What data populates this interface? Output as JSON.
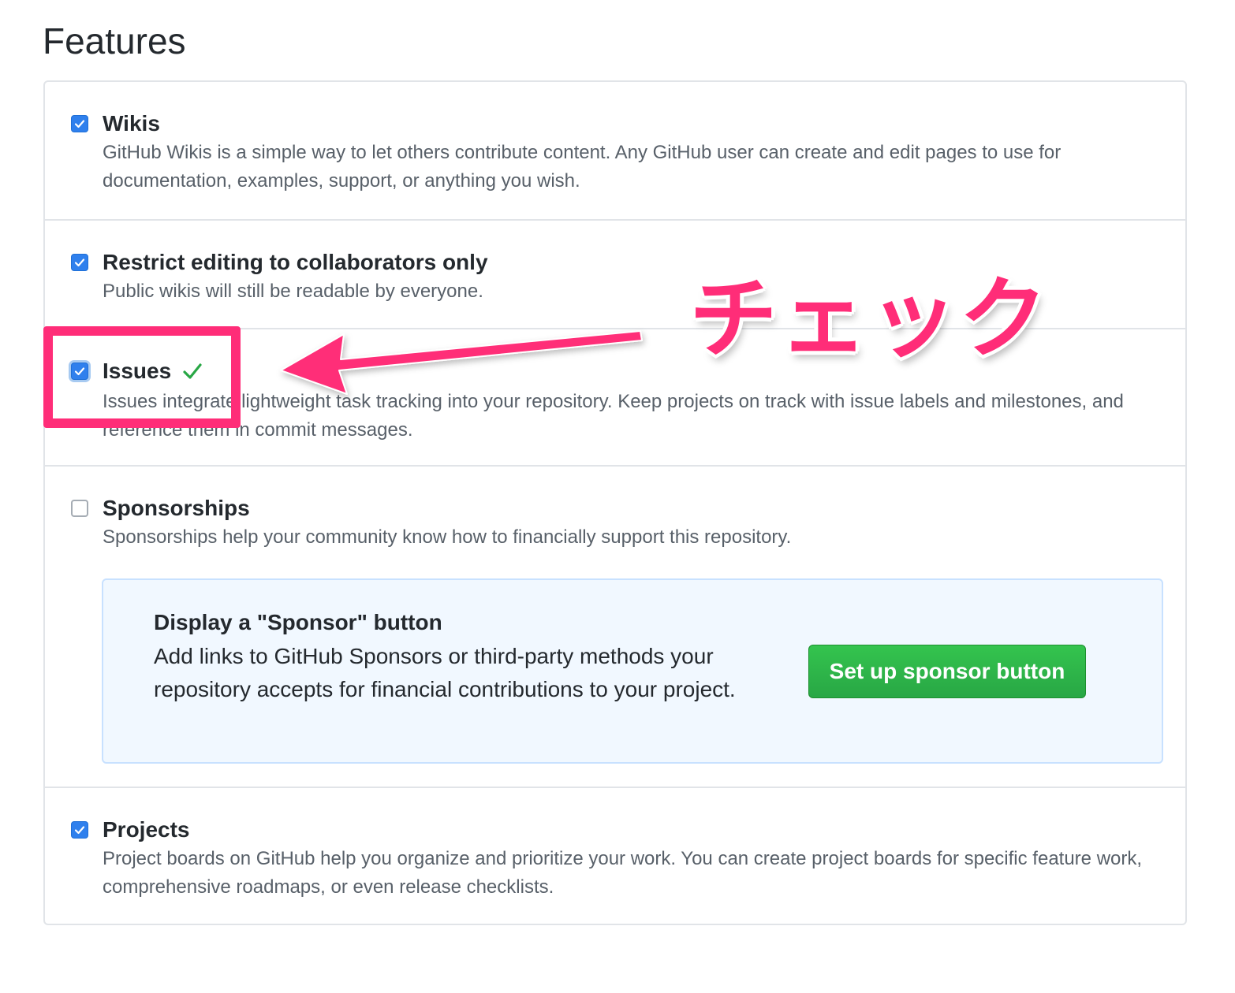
{
  "page": {
    "title": "Features"
  },
  "features": [
    {
      "id": "wikis",
      "title": "Wikis",
      "description": "GitHub Wikis is a simple way to let others contribute content. Any GitHub user can create and edit pages to use for documentation, examples, support, or anything you wish.",
      "checked": true
    },
    {
      "id": "restrict-editing",
      "title": "Restrict editing to collaborators only",
      "description": "Public wikis will still be readable by everyone.",
      "checked": true
    },
    {
      "id": "issues",
      "title": "Issues",
      "description": "Issues integrate lightweight task tracking into your repository. Keep projects on track with issue labels and milestones, and reference them in commit messages.",
      "checked": true,
      "status_icon": "check-icon"
    },
    {
      "id": "sponsorships",
      "title": "Sponsorships",
      "description": "Sponsorships help your community know how to financially support this repository.",
      "checked": false
    },
    {
      "id": "projects",
      "title": "Projects",
      "description": "Project boards on GitHub help you organize and prioritize your work. You can create project boards for specific feature work, comprehensive roadmaps, or even release checklists.",
      "checked": true
    }
  ],
  "sponsor_box": {
    "title": "Display a \"Sponsor\" button",
    "description": "Add links to GitHub Sponsors or third-party methods your repository accepts for financial contributions to your project.",
    "button_label": "Set up sponsor button"
  },
  "annotation": {
    "label": "チェック",
    "color": "#ff2d78"
  },
  "colors": {
    "checkbox_checked": "#2f80ed",
    "success_green": "#28a745",
    "sponsor_box_bg": "#f1f8ff",
    "border": "#e1e4e8"
  }
}
